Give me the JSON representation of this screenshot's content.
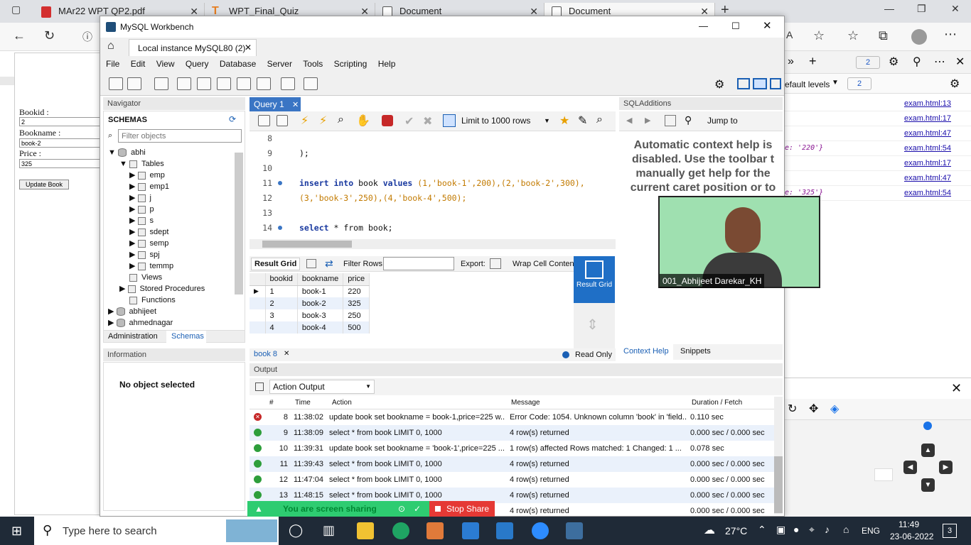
{
  "browser": {
    "tabs": [
      {
        "label": "MAr22 WPT QP2.pdf"
      },
      {
        "label": "WPT_Final_Quiz"
      },
      {
        "label": "Document"
      },
      {
        "label": "Document"
      }
    ]
  },
  "form": {
    "bookid_label": "Bookid :",
    "bookid_value": "2",
    "bookname_label": "Bookname :",
    "bookname_value": "book-2",
    "price_label": "Price :",
    "price_value": "325",
    "update_button": "Update Book"
  },
  "devtools": {
    "levels": "efault levels",
    "badge": "2",
    "badge2": "2",
    "lines": [
      {
        "value": "",
        "src": "exam.html:13"
      },
      {
        "value": "",
        "src": "exam.html:17"
      },
      {
        "value": "",
        "src": "exam.html:47"
      },
      {
        "value": "e: '220'}",
        "src": "exam.html:54"
      },
      {
        "value": "",
        "src": "exam.html:17"
      },
      {
        "value": "",
        "src": "exam.html:47"
      },
      {
        "value": "e: '325'}",
        "src": "exam.html:54"
      }
    ]
  },
  "workbench": {
    "title": "MySQL Workbench",
    "connection_tab": "Local instance MySQL80 (2)",
    "menu": [
      "File",
      "Edit",
      "View",
      "Query",
      "Database",
      "Server",
      "Tools",
      "Scripting",
      "Help"
    ],
    "navigator_title": "Navigator",
    "schemas_title": "SCHEMAS",
    "filter_placeholder": "Filter objects",
    "schema_abhi": "abhi",
    "tables_label": "Tables",
    "tables": [
      "emp",
      "emp1",
      "j",
      "p",
      "s",
      "sdept",
      "semp",
      "spj",
      "temmp"
    ],
    "views_label": "Views",
    "procs_label": "Stored Procedures",
    "functions_label": "Functions",
    "schema_abhijeet": "abhijeet",
    "schema_ahmednagar": "ahmednagar",
    "tab_administration": "Administration",
    "tab_schemas": "Schemas",
    "information_title": "Information",
    "no_object": "No object selected",
    "query_tab": "Query 1",
    "limit_rows": "Limit to 1000 rows",
    "code": {
      "l8": "8",
      "l9": "9",
      "l10": "10",
      "l11": "11",
      "l12": "12",
      "l13": "13",
      "l14": "14",
      "close_paren": ");",
      "insert_kw": "insert into",
      "insert_rest_table": "book",
      "values_kw": "values",
      "insert_vals1": "(1,'book-1',200),(2,'book-2',300),",
      "insert_vals2": "(3,'book-3',250),(4,'book-4',500);",
      "select_kw": "select",
      "select_rest": "* from",
      "select_table": "book;"
    },
    "result_grid_label": "Result Grid",
    "filter_rows_label": "Filter Rows:",
    "export_label": "Export:",
    "wrap_label": "Wrap Cell Content:",
    "result_side_label": "Result Grid",
    "columns": [
      "bookid",
      "bookname",
      "price"
    ],
    "rows": [
      [
        "1",
        "book-1",
        "220"
      ],
      [
        "2",
        "book-2",
        "325"
      ],
      [
        "3",
        "book-3",
        "250"
      ],
      [
        "4",
        "book-4",
        "500"
      ]
    ],
    "result_tab": "book 8",
    "read_only": "Read Only",
    "sqladditions_title": "SQLAdditions",
    "jump_to": "Jump to",
    "context_help_text": "Automatic context help is disabled. Use the toolbar t manually get help for the current caret position or to togg",
    "context_help_tab": "Context Help",
    "snippets_tab": "Snippets",
    "output_title": "Output",
    "action_output": "Action Output",
    "out_columns": [
      "#",
      "Time",
      "Action",
      "Message",
      "Duration / Fetch"
    ],
    "out_rows": [
      {
        "status": "error",
        "n": "8",
        "time": "11:38:02",
        "action": "update book set bookname = book-1,price=225 w...",
        "message": "Error Code: 1054. Unknown column 'book' in 'field...",
        "duration": "0.110 sec"
      },
      {
        "status": "ok",
        "n": "9",
        "time": "11:38:09",
        "action": "select * from book LIMIT 0, 1000",
        "message": "4 row(s) returned",
        "duration": "0.000 sec / 0.000 sec"
      },
      {
        "status": "ok",
        "n": "10",
        "time": "11:39:31",
        "action": "update book set bookname = 'book-1',price=225 ...",
        "message": "1 row(s) affected Rows matched: 1  Changed: 1  ...",
        "duration": "0.078 sec"
      },
      {
        "status": "ok",
        "n": "11",
        "time": "11:39:43",
        "action": "select * from book LIMIT 0, 1000",
        "message": "4 row(s) returned",
        "duration": "0.000 sec / 0.000 sec"
      },
      {
        "status": "ok",
        "n": "12",
        "time": "11:47:04",
        "action": "select * from book LIMIT 0, 1000",
        "message": "4 row(s) returned",
        "duration": "0.000 sec / 0.000 sec"
      },
      {
        "status": "ok",
        "n": "13",
        "time": "11:48:15",
        "action": "select * from book LIMIT 0, 1000",
        "message": "4 row(s) returned",
        "duration": "0.000 sec / 0.000 sec"
      },
      {
        "status": "ok",
        "n": "",
        "time": "",
        "action": "",
        "message": "4 row(s) returned",
        "duration": "0.000 sec / 0.000 sec"
      }
    ]
  },
  "webcam_name": "001_Abhijeet Darekar_KH",
  "screen_share": {
    "label": "You are screen sharing",
    "stop": "Stop Share"
  },
  "taskbar": {
    "search_placeholder": "Type here to search",
    "weather": "27°C",
    "lang": "ENG",
    "time": "11:49",
    "date": "23-06-2022",
    "notifications": "3"
  }
}
